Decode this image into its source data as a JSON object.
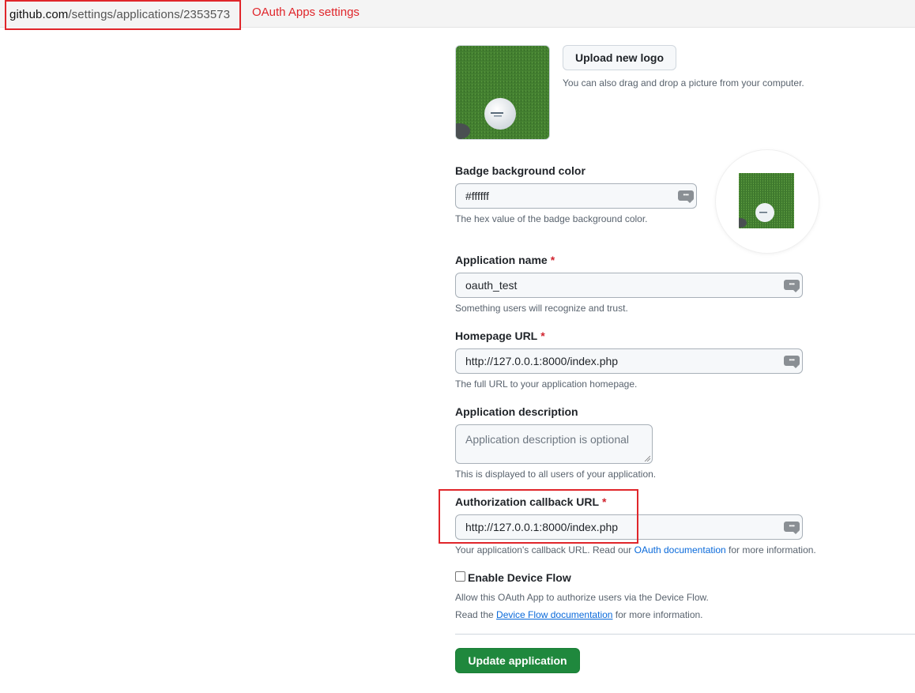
{
  "address_bar": {
    "host": "github.com",
    "path": "/settings/applications/2353573"
  },
  "annotation": {
    "label": "OAuth Apps settings",
    "color": "#e0262b"
  },
  "logo": {
    "upload_button": "Upload new logo",
    "drag_note": "You can also drag and drop a picture from your computer."
  },
  "badge_color": {
    "label": "Badge background color",
    "value": "#ffffff",
    "hint": "The hex value of the badge background color."
  },
  "app_name": {
    "label": "Application name",
    "required_mark": "*",
    "value": "oauth_test",
    "hint": "Something users will recognize and trust."
  },
  "homepage_url": {
    "label": "Homepage URL",
    "required_mark": "*",
    "value": "http://127.0.0.1:8000/index.php",
    "hint": "The full URL to your application homepage."
  },
  "app_description": {
    "label": "Application description",
    "placeholder": "Application description is optional",
    "hint": "This is displayed to all users of your application."
  },
  "callback_url": {
    "label": "Authorization callback URL",
    "required_mark": "*",
    "value": "http://127.0.0.1:8000/index.php",
    "hint_prefix": "Your application's callback URL. Read our ",
    "hint_link": "OAuth documentation",
    "hint_suffix": " for more information."
  },
  "device_flow": {
    "label": "Enable Device Flow",
    "checked": false,
    "hint_line1": "Allow this OAuth App to authorize users via the Device Flow.",
    "hint_line2_prefix": "Read the ",
    "hint_line2_link": "Device Flow documentation",
    "hint_line2_suffix": " for more information."
  },
  "actions": {
    "update_button": "Update application"
  },
  "icons": {
    "password_manager": "password-manager-icon",
    "resize": "resize-grip-icon"
  },
  "colors": {
    "primary_button": "#1f883d",
    "link": "#0969da",
    "required": "#d1242f"
  }
}
